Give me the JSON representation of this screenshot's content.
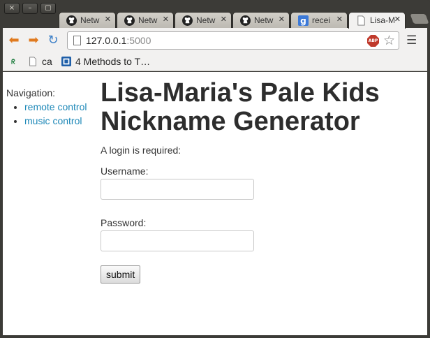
{
  "window": {
    "controls": [
      "×",
      "–",
      "▢"
    ]
  },
  "tabs": [
    {
      "title": "Netw",
      "favicon": "github-icon",
      "active": false
    },
    {
      "title": "Netw",
      "favicon": "github-icon",
      "active": false
    },
    {
      "title": "Netw",
      "favicon": "github-icon",
      "active": false
    },
    {
      "title": "Netw",
      "favicon": "github-icon",
      "active": false
    },
    {
      "title": "recei",
      "favicon": "google-icon",
      "active": false
    },
    {
      "title": "Lisa-M",
      "favicon": "page-icon",
      "active": true
    }
  ],
  "toolbar": {
    "url_host": "127.0.0.1",
    "url_port": ":5000",
    "adblock_label": "ABP"
  },
  "bookmarks": [
    {
      "label": "",
      "icon": "bookmark-r-icon"
    },
    {
      "label": "ca",
      "icon": "page-icon"
    },
    {
      "label": "4 Methods to T…",
      "icon": "blue-square-icon"
    }
  ],
  "sidebar": {
    "label": "Navigation:",
    "items": [
      {
        "label": "remote control"
      },
      {
        "label": "music control"
      }
    ]
  },
  "main": {
    "title": "Lisa-Maria's Pale Kids Nickname Generator",
    "login_note": "A login is required:",
    "username_label": "Username:",
    "password_label": "Password:",
    "submit_label": "submit"
  },
  "colors": {
    "link": "#1e88b8",
    "heading": "#2d2d2d",
    "chrome_dark": "#3c3b37"
  }
}
